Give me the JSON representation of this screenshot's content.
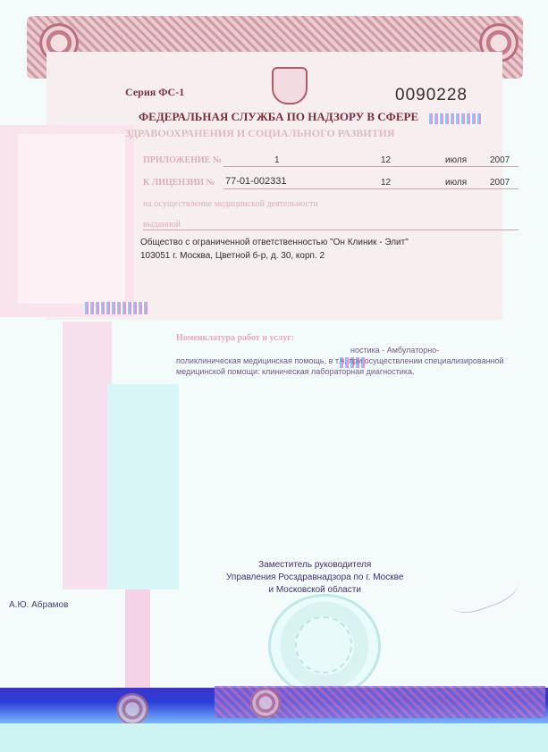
{
  "document": {
    "series": "Серия ФС-1",
    "number": "0090228",
    "heading": "ФЕДЕРАЛЬНАЯ СЛУЖБА ПО НАДЗОРУ В СФЕРЕ",
    "heading_line2": "ЗДРАВООХРАНЕНИЯ И СОЦИАЛЬНОГО РАЗВИТИЯ",
    "row1": {
      "label": "ПРИЛОЖЕНИЕ №",
      "value": "1",
      "day": "12",
      "month": "июля",
      "year": "2007"
    },
    "row2": {
      "label": "К ЛИЦЕНЗИИ №",
      "value": "77-01-002331",
      "day": "12",
      "month": "июля",
      "year": "2007"
    },
    "row3_label": "на осуществление медицинской деятельности",
    "row4_label": "выданной",
    "org_line1": "Общество с ограниченной ответственностью \"Он Клиник - Элит\"",
    "org_line2": "103051 г. Москва, Цветной б-р, д. 30, корп. 2",
    "services_label": "Номенклатура работ и услуг:",
    "body_line1": "                                                                              ностика - Амбулаторно-",
    "body_line2": "поликлиническая медицинская помощь, в т.ч. при осуществлении специализированной",
    "body_line3": "медицинской помощи: клиническая лабораторная диагностика.",
    "signer_line1": "Заместитель руководителя",
    "signer_line2": "Управления Росздравнадзора по г. Москве",
    "signer_line3": "и Московской области",
    "signer_name": "А.Ю. Абрамов"
  },
  "colors": {
    "frame": "#c98a96",
    "heading": "#7d2c3c",
    "text": "#2e2e2e"
  },
  "icons": [
    "coat-of-arms-icon",
    "rosette-icon",
    "seal-icon"
  ]
}
